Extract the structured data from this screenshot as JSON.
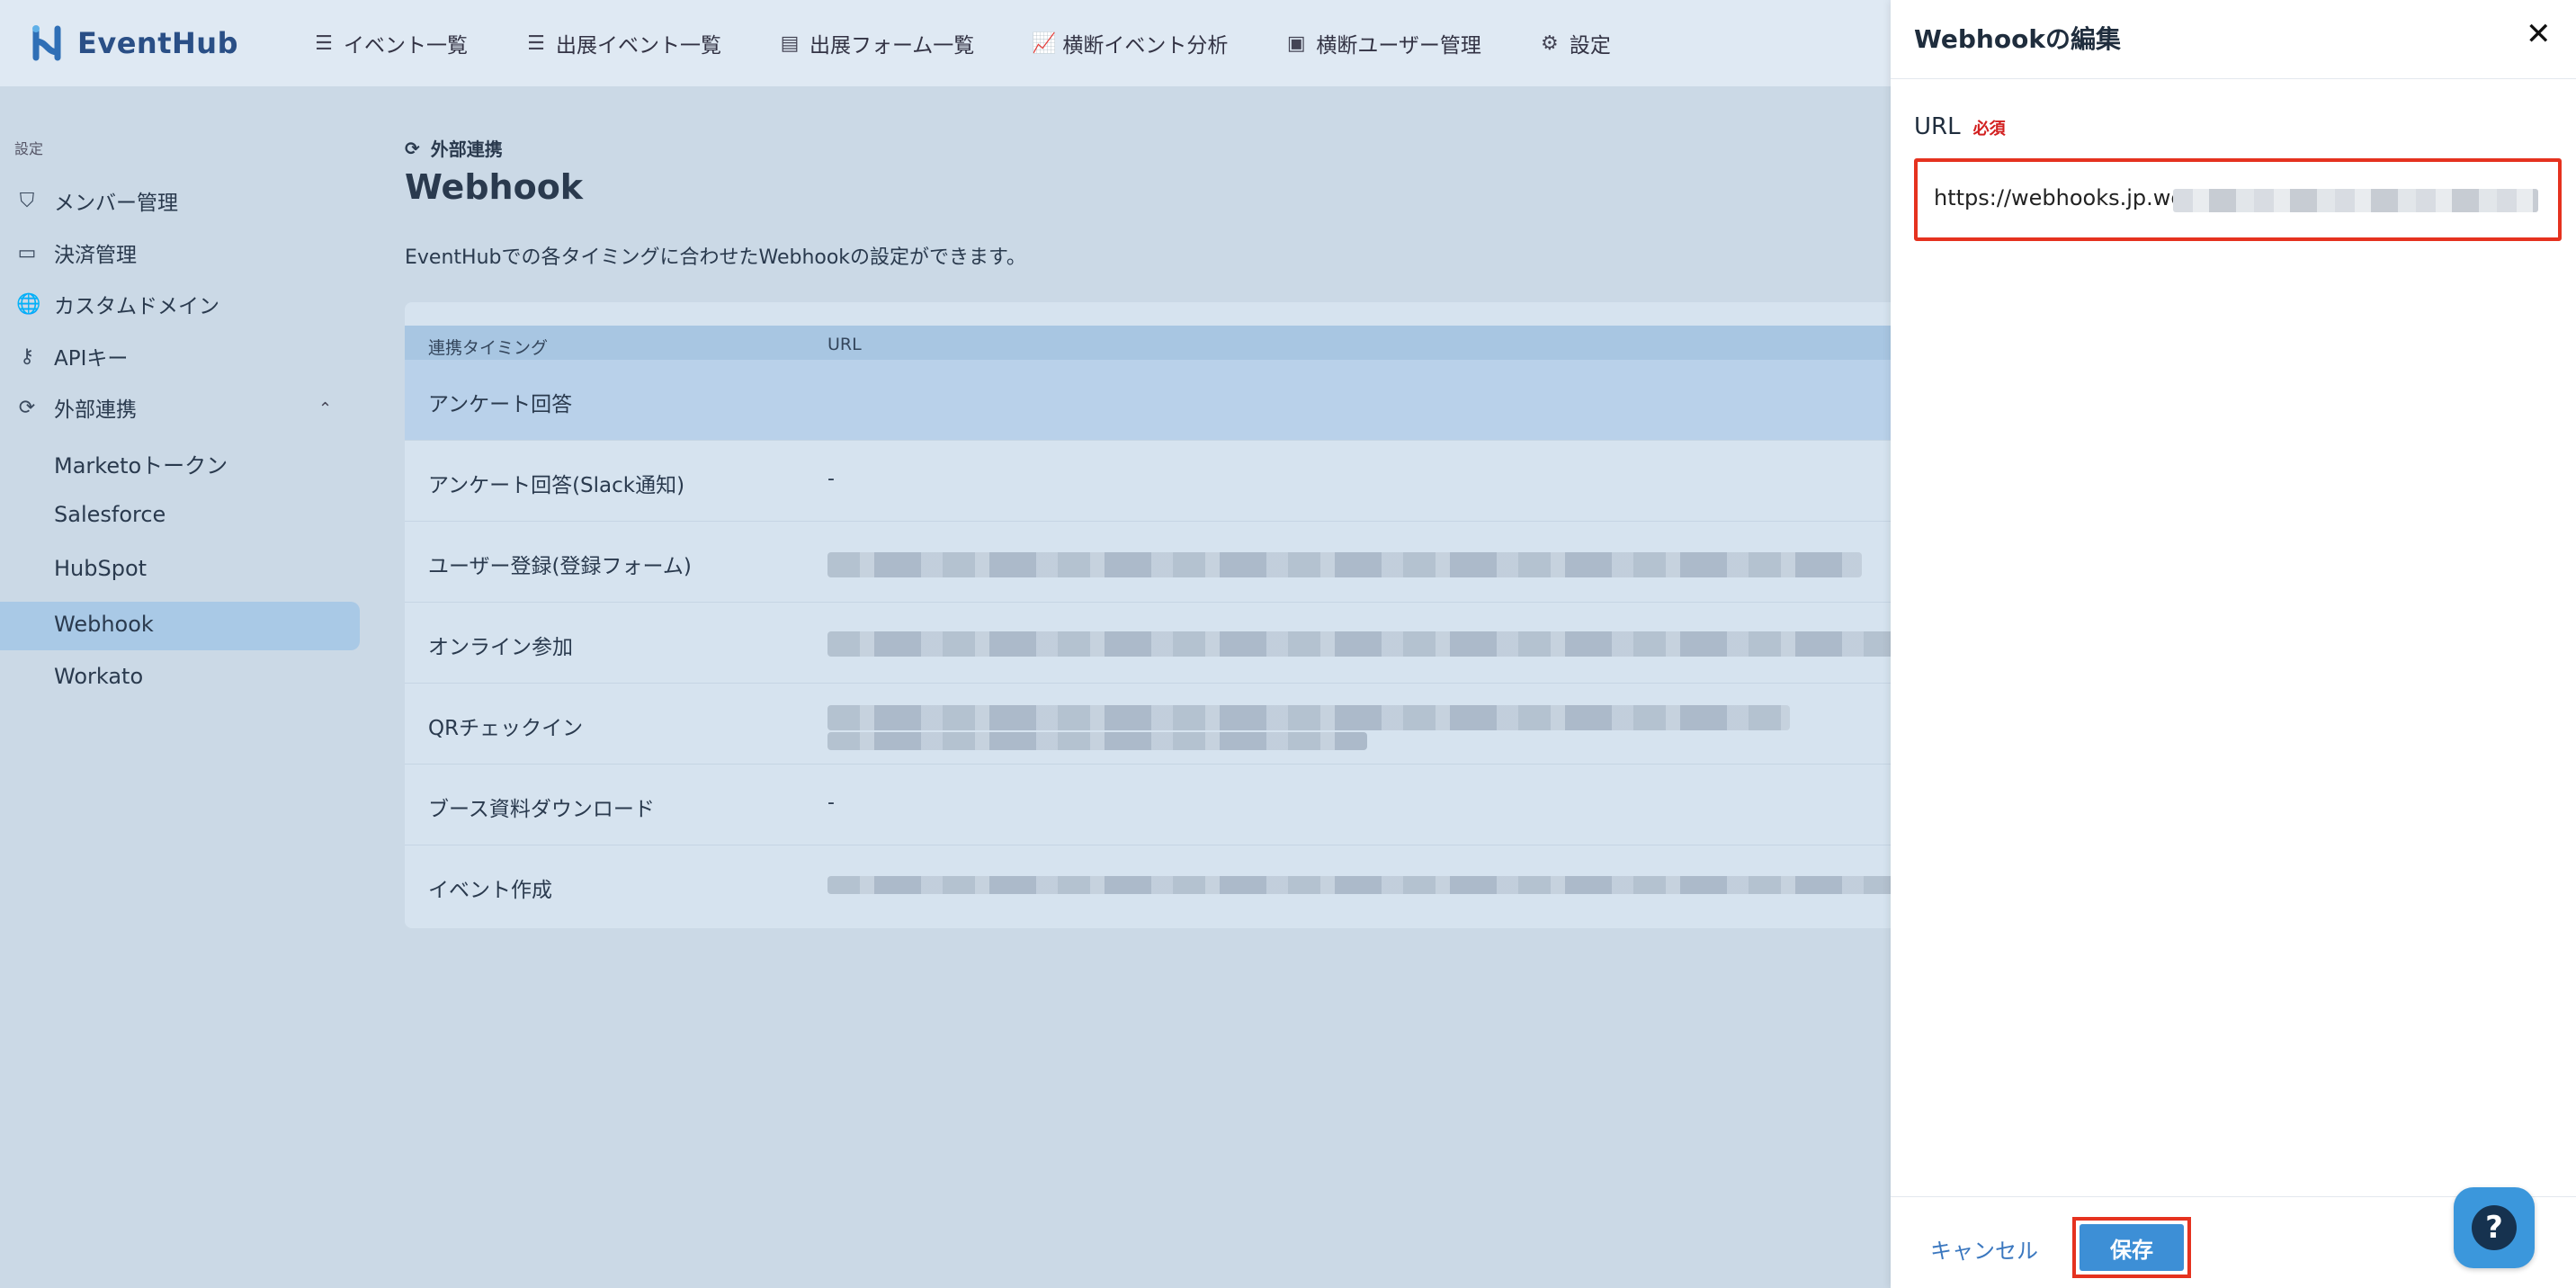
{
  "app": {
    "name": "EventHub"
  },
  "nav": [
    {
      "icon": "list-icon",
      "label": "イベント一覧"
    },
    {
      "icon": "list-icon",
      "label": "出展イベント一覧"
    },
    {
      "icon": "form-icon",
      "label": "出展フォーム一覧"
    },
    {
      "icon": "chart-icon",
      "label": "横断イベント分析"
    },
    {
      "icon": "id-card-icon",
      "label": "横断ユーザー管理"
    },
    {
      "icon": "gear-icon",
      "label": "設定"
    }
  ],
  "sidebar": {
    "caption": "設定",
    "items": [
      {
        "icon": "shield-icon",
        "label": "メンバー管理"
      },
      {
        "icon": "card-icon",
        "label": "決済管理"
      },
      {
        "icon": "globe-icon",
        "label": "カスタムドメイン"
      },
      {
        "icon": "key-icon",
        "label": "APIキー"
      },
      {
        "icon": "sync-icon",
        "label": "外部連携"
      }
    ],
    "subitems": [
      "Marketoトークン",
      "Salesforce",
      "HubSpot",
      "Webhook",
      "Workato"
    ],
    "active_subitem": "Webhook"
  },
  "main": {
    "breadcrumb": "外部連携",
    "title": "Webhook",
    "description": "EventHubでの各タイミングに合わせたWebhookの設定ができます。",
    "table": {
      "headers": [
        "連携タイミング",
        "URL"
      ],
      "rows": [
        {
          "timing": "アンケート回答",
          "url": ""
        },
        {
          "timing": "アンケート回答(Slack通知)",
          "url": "-"
        },
        {
          "timing": "ユーザー登録(登録フォーム)",
          "url": ""
        },
        {
          "timing": "オンライン参加",
          "url": ""
        },
        {
          "timing": "QRチェックイン",
          "url": ""
        },
        {
          "timing": "ブース資料ダウンロード",
          "url": "-"
        },
        {
          "timing": "イベント作成",
          "url": ""
        }
      ]
    }
  },
  "drawer": {
    "title": "Webhookの編集",
    "field_label": "URL",
    "required_badge": "必須",
    "url_value": "https://webhooks.jp.wc",
    "cancel_label": "キャンセル",
    "save_label": "保存"
  },
  "help": {
    "label": "?"
  },
  "colors": {
    "accent": "#3d8fd6",
    "highlight": "#e5321f",
    "required": "#d21f1f"
  }
}
